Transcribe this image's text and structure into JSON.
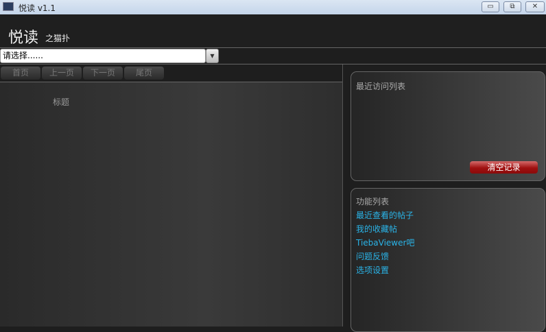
{
  "window": {
    "title": "悦读 v1.1",
    "minimize": "▭",
    "restore": "⧉",
    "close": "✕"
  },
  "header": {
    "logo": "悦读",
    "subtitle": "之猫扑"
  },
  "selector": {
    "value": "请选择......",
    "arrow": "▼"
  },
  "nav": {
    "first": "首页",
    "prev": "上一页",
    "next": "下一页",
    "last": "尾页"
  },
  "list": {
    "column_title": "标题"
  },
  "recent": {
    "title": "最近访问列表",
    "clear": "清空记录"
  },
  "functions": {
    "title": "功能列表",
    "items": [
      "最近查看的帖子",
      "我的收藏帖",
      "TiebaViewer吧",
      "问题反馈",
      "选项设置"
    ]
  }
}
